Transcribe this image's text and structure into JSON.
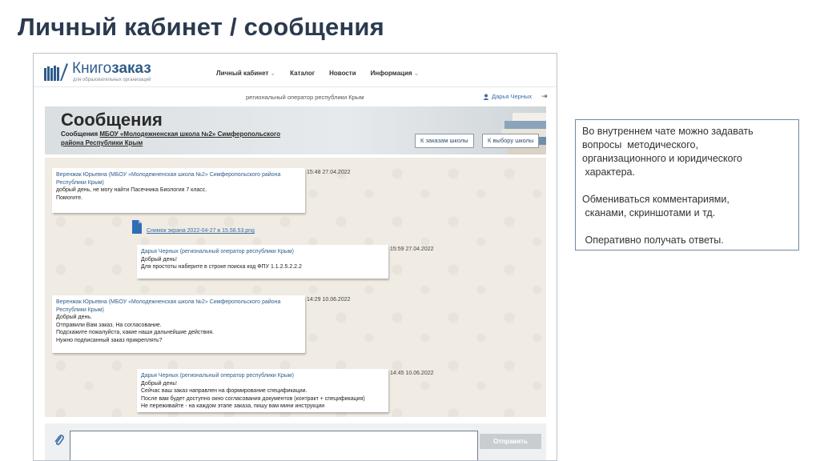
{
  "slide_title": "Личный кабинет / сообщения",
  "site": {
    "logo_prefix": "Книго",
    "logo_bold": "заказ",
    "logo_tagline": "для образовательных организаций",
    "nav": [
      {
        "label": "Личный кабинет",
        "has_dropdown": true
      },
      {
        "label": "Каталог",
        "has_dropdown": false
      },
      {
        "label": "Новости",
        "has_dropdown": false
      },
      {
        "label": "Информация",
        "has_dropdown": true
      }
    ],
    "region": "региональный оператор республики Крым",
    "user_name": "Дарья Черных"
  },
  "banner": {
    "title": "Сообщения",
    "subtitle_prefix": "Сообщения ",
    "subtitle_link": "МБОУ «Молодежненская школа №2» Симферопольского района Республики Крым",
    "btn_school_orders": "К заказам школы",
    "btn_school_choice": "К выбору школы"
  },
  "chat": {
    "messages": [
      {
        "author": "Веренжак Юрьевна (МБОУ «Молодежненская школа №2» Симферопольского района Республики Крым)",
        "lines": [
          "добрый день, не могу найти Пасечника Биология 7 класс.",
          "Помогите."
        ],
        "time": "15:48 27.04.2022"
      },
      {
        "author": "Дарья Черных (региональный оператор республики Крым)",
        "lines": [
          "Добрый день!",
          "Для простоты наберите в строке поиска код ФПУ 1.1.2.5.2.2.2"
        ],
        "time": "15:59 27.04.2022"
      },
      {
        "author": "Веренжак Юрьевна (МБОУ «Молодежненская школа №2» Симферопольского района Республики Крым)",
        "lines": [
          "Добрый день.",
          "Отправили Вам заказ. На согласование.",
          "Подскажите пожалуйста, какие наши дальнейшие действия.",
          "Нужно подписанный заказ прикреплять?"
        ],
        "time": "14:29 10.06.2022"
      },
      {
        "author": "Дарья Черных (региональный оператор республики Крым)",
        "lines": [
          "Добрый день!",
          "Сейчас ваш заказ направлен на формирование спецификации.",
          "После вам будет доступно окно согласования документов (контракт + спецификация)",
          "Не переживайте - на каждом этапе заказа, пишу вам мини инструкции"
        ],
        "time": "14:45 10.06.2022"
      }
    ],
    "file_link": "Снимок экрана 2022-04-27 в 15.58.53.png"
  },
  "composer": {
    "input_value": "",
    "input_placeholder": "",
    "send_label": "Отправить"
  },
  "note": {
    "lines": [
      "Во внутреннем чате можно задавать",
      "вопросы  методического,",
      "организационного и юридического",
      " характера.",
      "",
      "Обмениваться комментариями,",
      " сканами, скриншотами и тд.",
      "",
      " Оперативно получать ответы."
    ]
  },
  "colors": {
    "title": "#2b3a4e",
    "link": "#3a6ea5",
    "chat_bg": "#f0ebe3",
    "send_button": "#c9cdd1",
    "note_border": "#6f8aa0"
  },
  "icons": [
    "logo-books-icon",
    "user-icon",
    "logout-icon",
    "file-icon",
    "paperclip-icon"
  ]
}
